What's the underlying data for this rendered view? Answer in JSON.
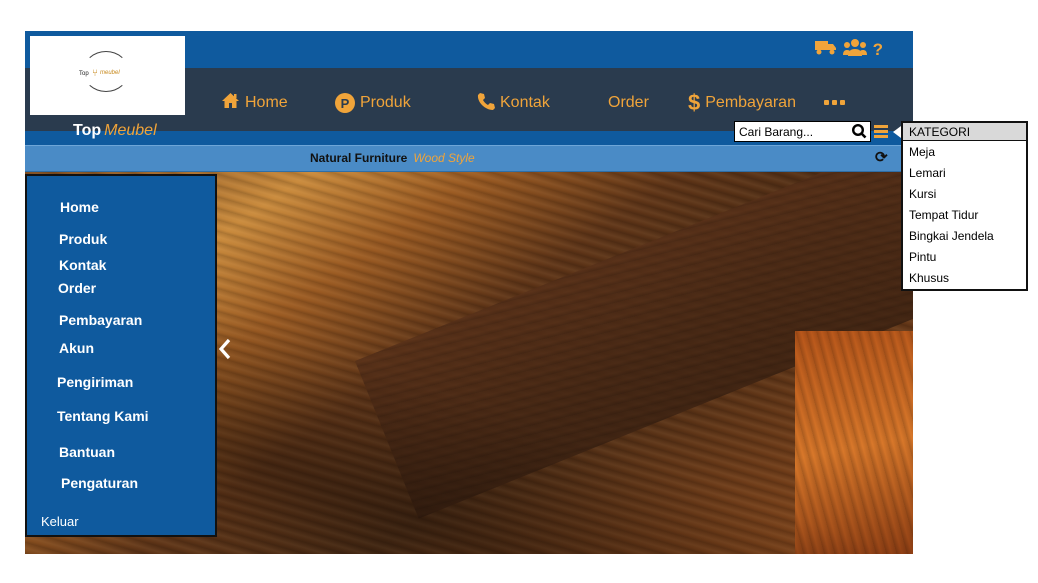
{
  "brand": {
    "name": "Top",
    "sub": "Meubel"
  },
  "logo": {
    "text_top": "Top",
    "text_meubel": "meubel"
  },
  "top_icons": [
    "truck-icon",
    "users-icon",
    "help-icon"
  ],
  "nav": {
    "home": "Home",
    "produk": "Produk",
    "kontak": "Kontak",
    "order": "Order",
    "pembayaran": "Pembayaran",
    "p_glyph": "P",
    "dollar_glyph": "$"
  },
  "search": {
    "placeholder": "Cari Barang..."
  },
  "tagline": {
    "main": "Natural Furniture",
    "sub": "Wood Style"
  },
  "sidebar": {
    "items": [
      "Home",
      "Produk",
      "Kontak",
      "Order",
      "Pembayaran",
      "Akun",
      "Pengiriman",
      "Tentang Kami",
      "Bantuan",
      "Pengaturan",
      "Keluar"
    ]
  },
  "kategori": {
    "header": "KATEGORI",
    "items": [
      "Meja",
      "Lemari",
      "Kursi",
      "Tempat Tidur",
      "Bingkai Jendela",
      "Pintu",
      "Khusus"
    ]
  },
  "colors": {
    "accent": "#f0a43a",
    "primary": "#0f5a9e",
    "nav_bg": "#2a3b4e"
  }
}
